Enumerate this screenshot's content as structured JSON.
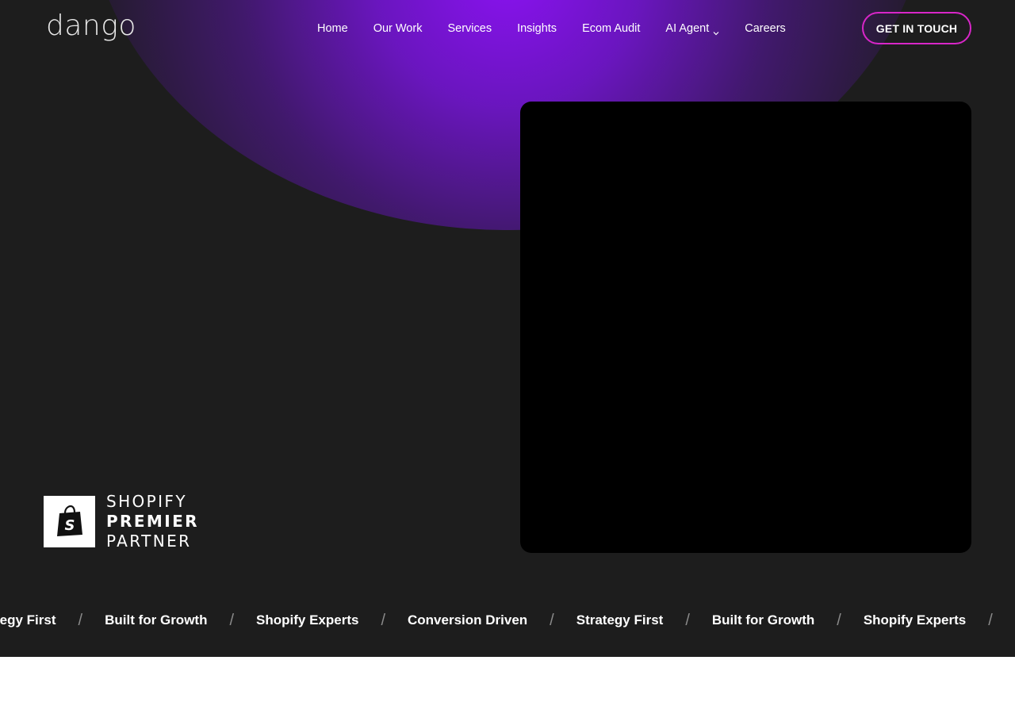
{
  "brand": {
    "logo_text": "dango"
  },
  "nav": {
    "items": [
      {
        "label": "Home"
      },
      {
        "label": "Our Work"
      },
      {
        "label": "Services"
      },
      {
        "label": "Insights"
      },
      {
        "label": "Ecom Audit"
      },
      {
        "label": "AI Agent",
        "has_dropdown": true
      },
      {
        "label": "Careers"
      }
    ],
    "cta_label": "GET IN TOUCH"
  },
  "badge": {
    "line1": "SHOPIFY",
    "line2": "PREMIER",
    "line3": "PARTNER"
  },
  "marquee": {
    "items": [
      "tegy First",
      "Built for Growth",
      "Shopify Experts",
      "Conversion Driven",
      "Strategy First",
      "Built for Growth",
      "Shopify Experts"
    ],
    "separator": "/"
  },
  "colors": {
    "background": "#1d1d1d",
    "accent_purple": "#8a12f0",
    "cta_border": "#d826c8",
    "video_bg": "#000000"
  }
}
